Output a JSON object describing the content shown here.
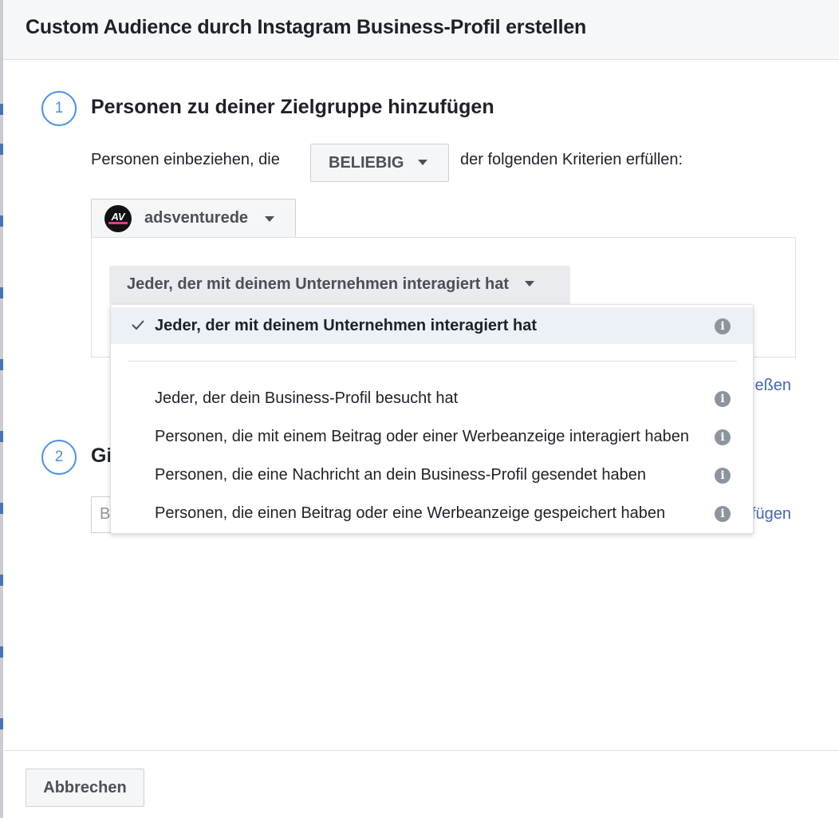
{
  "dialog": {
    "title": "Custom Audience durch Instagram Business-Profil erstellen"
  },
  "step1": {
    "number": "1",
    "title": "Personen zu deiner Zielgruppe hinzufügen",
    "include_prefix": "Personen einbeziehen, die",
    "include_selector": "BELIEBIG",
    "include_suffix": "der folgenden Kriterien erfüllen:",
    "account": {
      "avatar_text": "AV",
      "name": "adsventurede"
    },
    "engagement_selector": "Jeder, der mit deinem Unternehmen interagiert hat",
    "exclude_link_partial": "ießen"
  },
  "step2": {
    "number": "2",
    "title_partial": "Gi",
    "input_partial": "B",
    "add_link_partial": "fügen"
  },
  "dropdown": {
    "options": [
      {
        "label": "Jeder, der mit deinem Unternehmen interagiert hat",
        "selected": true
      },
      {
        "label": "Jeder, der dein Business-Profil besucht hat",
        "selected": false
      },
      {
        "label": "Personen, die mit einem Beitrag oder einer Werbeanzeige interagiert haben",
        "selected": false
      },
      {
        "label": "Personen, die eine Nachricht an dein Business-Profil gesendet haben",
        "selected": false
      },
      {
        "label": "Personen, die einen Beitrag oder eine Werbeanzeige gespeichert haben",
        "selected": false
      }
    ],
    "info_glyph": "i"
  },
  "footer": {
    "cancel_label": "Abbrechen"
  },
  "icons": {
    "check": "checkmark-icon",
    "info": "info-icon",
    "caret": "caret-down-icon"
  },
  "colors": {
    "accent": "#4a90e2",
    "link": "#4267b2",
    "selected_bg": "#ecf0f7"
  }
}
